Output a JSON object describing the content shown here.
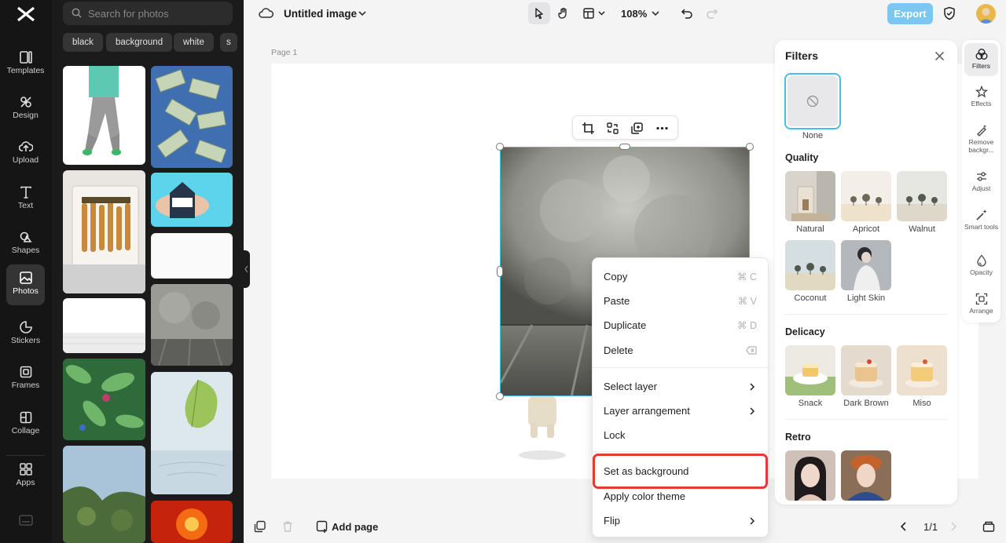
{
  "app": {
    "title": "Untitled image",
    "zoom": "108%",
    "export_label": "Export",
    "page_label": "Page 1",
    "add_page_label": "Add page",
    "page_indicator": "1/1"
  },
  "rail": {
    "items": [
      {
        "label": "Templates",
        "icon": "templates-icon"
      },
      {
        "label": "Design",
        "icon": "design-icon"
      },
      {
        "label": "Upload",
        "icon": "upload-icon"
      },
      {
        "label": "Text",
        "icon": "text-icon"
      },
      {
        "label": "Shapes",
        "icon": "shapes-icon"
      },
      {
        "label": "Photos",
        "icon": "photos-icon",
        "active": true
      },
      {
        "label": "Stickers",
        "icon": "stickers-icon"
      },
      {
        "label": "Frames",
        "icon": "frames-icon"
      },
      {
        "label": "Collage",
        "icon": "collage-icon"
      },
      {
        "label": "Apps",
        "icon": "apps-icon"
      }
    ]
  },
  "photos_panel": {
    "search_placeholder": "Search for photos",
    "chips": [
      "black",
      "background",
      "white",
      "s"
    ]
  },
  "context_menu": {
    "items": [
      {
        "label": "Copy",
        "shortcut": "⌘ C"
      },
      {
        "label": "Paste",
        "shortcut": "⌘ V"
      },
      {
        "label": "Duplicate",
        "shortcut": "⌘ D"
      },
      {
        "label": "Delete",
        "shortcut": "backspace-icon"
      },
      {
        "label": "Select layer",
        "submenu": true
      },
      {
        "label": "Layer arrangement",
        "submenu": true
      },
      {
        "label": "Lock"
      },
      {
        "label": "Set as background",
        "highlighted": true
      },
      {
        "label": "Apply color theme"
      },
      {
        "label": "Flip",
        "submenu": true
      }
    ]
  },
  "filters": {
    "title": "Filters",
    "none_label": "None",
    "sections": [
      {
        "title": "Quality",
        "items": [
          "Natural",
          "Apricot",
          "Walnut",
          "Coconut",
          "Light Skin"
        ]
      },
      {
        "title": "Delicacy",
        "items": [
          "Snack",
          "Dark Brown",
          "Miso"
        ]
      },
      {
        "title": "Retro",
        "items": [
          "",
          ""
        ]
      }
    ]
  },
  "right_tools": [
    {
      "label": "Filters",
      "active": true
    },
    {
      "label": "Effects"
    },
    {
      "label": "Remove backgr..."
    },
    {
      "label": "Adjust"
    },
    {
      "label": "Smart tools"
    },
    {
      "label": "Opacity"
    },
    {
      "label": "Arrange"
    }
  ],
  "colors": {
    "accent": "#49bde6",
    "export": "#7cc7f1",
    "highlight": "#e53935",
    "rail": "#151515"
  }
}
